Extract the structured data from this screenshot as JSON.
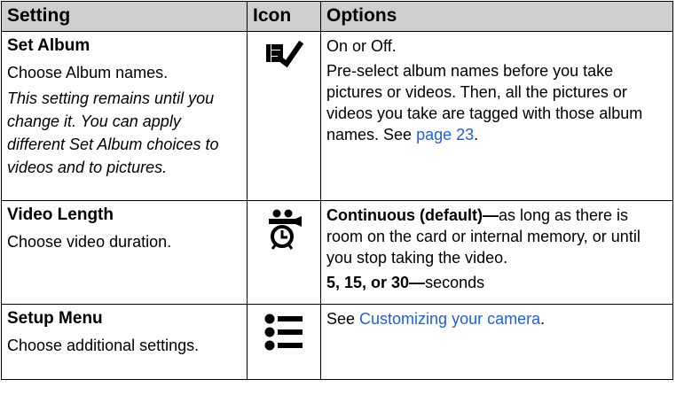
{
  "header": {
    "col_setting": "Setting",
    "col_icon": "Icon",
    "col_options": "Options"
  },
  "rows": [
    {
      "title": "Set Album",
      "desc": "Choose Album names.",
      "note": "This setting remains until you change it. You can apply different Set Album choices to videos and to pictures.",
      "icon": "album-check-icon",
      "options": [
        {
          "text": "On or Off."
        },
        {
          "text_before": "Pre-select album names before you take pictures or videos. Then, all the pictures or videos you take are tagged with those album names. See ",
          "link": "page 23",
          "text_after": "."
        }
      ]
    },
    {
      "title": "Video Length",
      "desc": "Choose video duration.",
      "icon": "video-timer-icon",
      "options": [
        {
          "bold": "Continuous (default)—",
          "text": "as long as there is room on the card or internal memory, or until you stop taking the video."
        },
        {
          "bold": "5, 15, or 30—",
          "text": "seconds"
        }
      ]
    },
    {
      "title": "Setup Menu",
      "desc": "Choose additional settings.",
      "icon": "setup-list-icon",
      "options": [
        {
          "text_before": "See ",
          "link": "Customizing your camera",
          "text_after": "."
        }
      ]
    }
  ],
  "colors": {
    "header_bg": "#cfcfcf",
    "link": "#2060d8",
    "border": "#000000"
  }
}
